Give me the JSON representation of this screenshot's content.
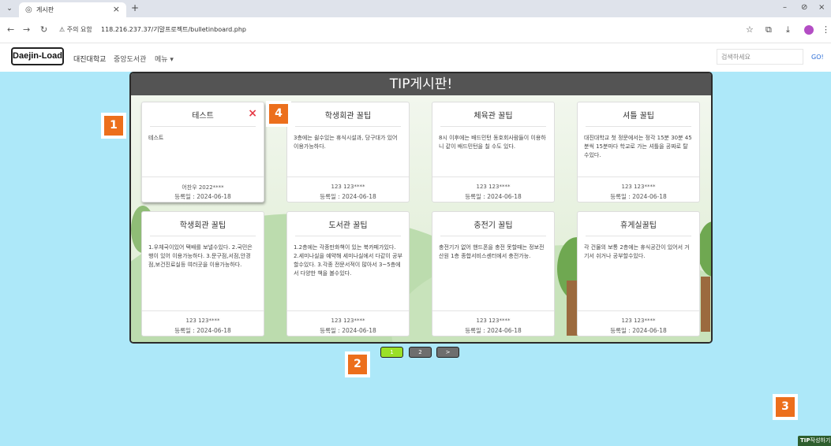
{
  "browser": {
    "tab_title": "게시판",
    "warning_text": "주의 요함",
    "url": "118.216.237.37/기말프로젝트/bulletinboard.php"
  },
  "header": {
    "logo": "Daejin-Load",
    "nav": [
      "대진대학교",
      "중앙도서관",
      "메뉴 ▾"
    ],
    "search_placeholder": "검색하세요",
    "go_label": "GO!"
  },
  "board": {
    "title": "TIP게시판!",
    "cards": [
      {
        "title": "테스트",
        "body": "테스트",
        "author": "어찬우 2022****",
        "date": "등록일 : 2024-06-18",
        "deletable": true
      },
      {
        "title": "학생회관 꿀팁",
        "body": "3층에는 쉴수있는 휴식시설과, 당구대가 있어 이용가능하다.",
        "author": "123 123****",
        "date": "등록일 : 2024-06-18"
      },
      {
        "title": "체육관 꿀팁",
        "body": "8시 이후에는 배드민턴 동호회사람들이 이용하니 같이 배드민턴을 칠 수도 있다.",
        "author": "123 123****",
        "date": "등록일 : 2024-06-18"
      },
      {
        "title": "셔틀 꿀팁",
        "body": "대진대학교 첫 정문에서는 정각 15분 30분 45분씩 15분마다 학교로 가는 셔틀을 공짜로 탈수있다.",
        "author": "123 123****",
        "date": "등록일 : 2024-06-18"
      },
      {
        "title": "학생회관 꿀팁",
        "body": "1.우체국이있어 택배를 보낼수있다. 2.국민은행이 있어 이용가능하다. 3.문구점,서점,안경점,보건진료실등 여러곳을 이용가능하다.",
        "author": "123 123****",
        "date": "등록일 : 2024-06-18"
      },
      {
        "title": "도서관 꿀팁",
        "body": "1.2층에는 각종만화책이 있는 북카페가있다. 2.세미나실을 예약해 세미나실에서 다같이 공부할수있다. 3.각종 전문서적이 많아서 3~5층에서 다양한 책을 볼수있다.",
        "author": "123 123****",
        "date": "등록일 : 2024-06-18"
      },
      {
        "title": "충전기 꿀팁",
        "body": "충전기가 없어 핸드폰을 충전 못할때는 정보전산원 1층 종합서비스센터에서 충전가능.",
        "author": "123 123****",
        "date": "등록일 : 2024-06-18"
      },
      {
        "title": "휴게실꿀팁",
        "body": "각 건물의 보통 2층에는 휴식공간이 있어서 거기서 쉬거나 공부할수있다.",
        "author": "123 123****",
        "date": "등록일 : 2024-06-18"
      }
    ],
    "delete_icon": "×"
  },
  "pagination": {
    "pages": [
      "1",
      "2"
    ],
    "next_label": ">",
    "active_page": "1",
    "colors": {
      "active": "#9be027",
      "inactive": "#6e6e6e"
    }
  },
  "badges": [
    "1",
    "2",
    "3",
    "4"
  ],
  "write_button": {
    "bold": "TIP",
    "label": "작성하기"
  },
  "colors": {
    "page_bg": "#ade8f9",
    "title_bar": "#545454",
    "badge": "#ec6f1c",
    "delete": "#e53945"
  }
}
